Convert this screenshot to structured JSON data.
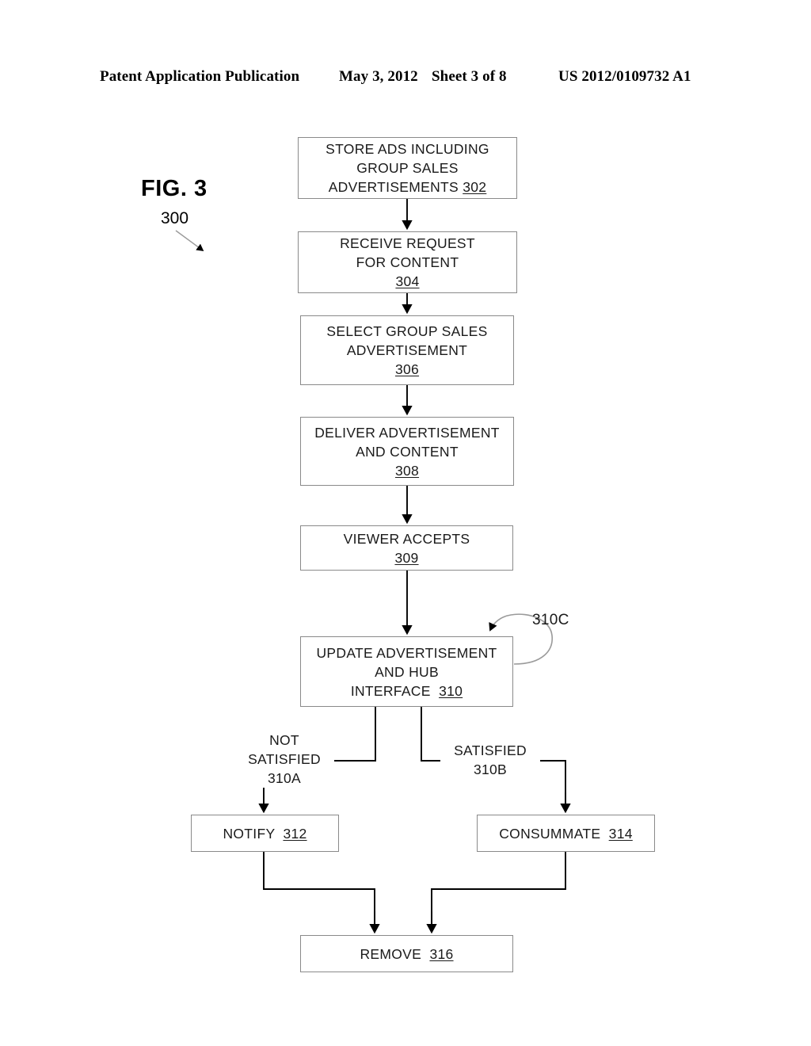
{
  "header": {
    "publication": "Patent Application Publication",
    "date": "May 3, 2012",
    "sheet": "Sheet 3 of 8",
    "number": "US 2012/0109732 A1"
  },
  "figure": {
    "label": "FIG. 3",
    "reference": "300"
  },
  "flowchart": {
    "type": "flowchart",
    "boxes": [
      {
        "id": "302",
        "lines": [
          "STORE ADS INCLUDING",
          "GROUP SALES",
          "ADVERTISEMENTS"
        ],
        "line1": "STORE ADS INCLUDING",
        "line2": "GROUP SALES",
        "line3": "ADVERTISEMENTS",
        "ref": "302",
        "ref_inline": true
      },
      {
        "id": "304",
        "line1": "RECEIVE REQUEST",
        "line2": "FOR CONTENT",
        "ref": "304",
        "ref_inline": false
      },
      {
        "id": "306",
        "line1": "SELECT GROUP SALES",
        "line2": "ADVERTISEMENT",
        "ref": "306",
        "ref_inline": false
      },
      {
        "id": "308",
        "line1": "DELIVER ADVERTISEMENT",
        "line2": "AND CONTENT",
        "ref": "308",
        "ref_inline": false
      },
      {
        "id": "309",
        "line1": "VIEWER ACCEPTS",
        "ref": "309",
        "ref_inline": false
      },
      {
        "id": "310",
        "line1": "UPDATE ADVERTISEMENT",
        "line2": "AND HUB",
        "line3": "INTERFACE",
        "ref": "310",
        "ref_inline": true
      },
      {
        "id": "312",
        "line1": "NOTIFY",
        "ref": "312",
        "ref_inline": true
      },
      {
        "id": "314",
        "line1": "CONSUMMATE",
        "ref": "314",
        "ref_inline": true
      },
      {
        "id": "316",
        "line1": "REMOVE",
        "ref": "316",
        "ref_inline": true
      }
    ],
    "branches": {
      "not_satisfied": {
        "line1": "NOT",
        "line2": "SATISFIED",
        "ref": "310A"
      },
      "satisfied": {
        "line1": "SATISFIED",
        "ref": "310B"
      },
      "loop": {
        "ref": "310C"
      }
    }
  },
  "colors": {
    "ink": "#1a1a1a",
    "box_border": "#8a8a8a",
    "line": "#000000",
    "background": "#ffffff"
  }
}
